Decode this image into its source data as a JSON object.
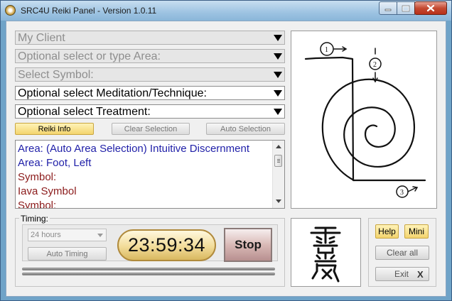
{
  "window": {
    "title": "SRC4U Reiki Panel - Version 1.0.11",
    "controls": {
      "minimize": "minimize-icon",
      "maximize": "maximize-icon",
      "close": "close-icon"
    }
  },
  "selectors": {
    "client": "My Client",
    "area": "Optional select or type Area:",
    "symbol": "Select Symbol:",
    "meditation": "Optional select Meditation/Technique:",
    "treatment": "Optional select Treatment:"
  },
  "buttons": {
    "reiki_info": "Reiki Info",
    "clear_selection": "Clear Selection",
    "auto_selection": "Auto Selection",
    "auto_timing": "Auto Timing",
    "stop": "Stop",
    "help": "Help",
    "mini": "Mini",
    "clear_all": "Clear all",
    "exit": "Exit",
    "exit_icon": "X"
  },
  "info_lines": [
    {
      "text": "Area: (Auto Area Selection) Intuitive Discernment",
      "color": "#1f1fa8"
    },
    {
      "text": "Area: Foot, Left",
      "color": "#1f1fa8"
    },
    {
      "text": "Symbol:",
      "color": "#8b1a1a"
    },
    {
      "text": "Iava Symbol",
      "color": "#8b1a1a"
    },
    {
      "text": "Symbol:",
      "color": "#8b1a1a"
    }
  ],
  "timing": {
    "label": "Timing:",
    "hours": "24 hours",
    "countdown": "23:59:34"
  },
  "symbol_image": {
    "name": "reiki-spiral-symbol",
    "step_labels": [
      "1",
      "2",
      "3"
    ]
  },
  "kanji_image": {
    "name": "reiki-kanji"
  },
  "colors": {
    "accent_gold": "#f3d46e",
    "blue_text": "#1f1fa8",
    "red_text": "#8b1a1a",
    "title_bar": "#9dc3e2"
  }
}
